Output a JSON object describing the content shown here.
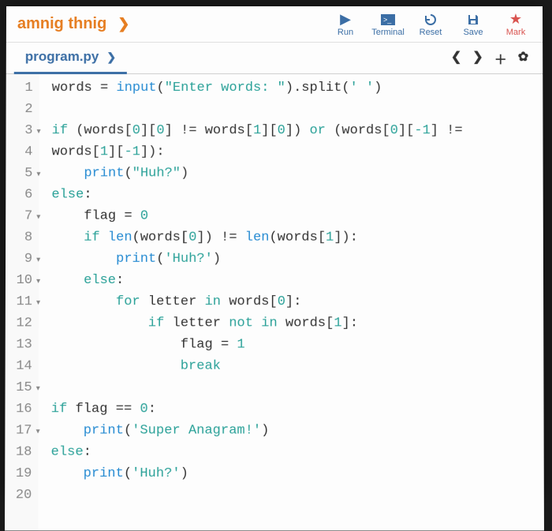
{
  "lesson": {
    "title": "amnig thnig"
  },
  "toolbar": {
    "run": "Run",
    "terminal": "Terminal",
    "reset": "Reset",
    "save": "Save",
    "mark": "Mark"
  },
  "tab": {
    "filename": "program.py"
  },
  "gutter": [
    "1",
    "2",
    "3",
    "4",
    "5",
    "6",
    "7",
    "8",
    "9",
    "10",
    "11",
    "12",
    "13",
    "14",
    "15",
    "16",
    "17",
    "18",
    "19",
    "20"
  ],
  "code": {
    "l1_a": "words = ",
    "l1_fn": "input",
    "l1_b": "(",
    "l1_str1": "\"Enter words: \"",
    "l1_c": ").split(",
    "l1_str2": "' '",
    "l1_d": ")",
    "l3_if": "if",
    "l3_a": " (words[",
    "l3_n0a": "0",
    "l3_b": "][",
    "l3_n0b": "0",
    "l3_c": "] != words[",
    "l3_n1a": "1",
    "l3_d": "][",
    "l3_n0c": "0",
    "l3_e": "]) ",
    "l3_or": "or",
    "l3_f": " (words[",
    "l3_n0d": "0",
    "l3_g": "][",
    "l3_nm1a": "-1",
    "l3_h": "] != ",
    "l3c_a": "words[",
    "l3c_n1": "1",
    "l3c_b": "][",
    "l3c_nm1": "-1",
    "l3c_c": "]):",
    "l4_print": "print",
    "l4_a": "(",
    "l4_str": "\"Huh?\"",
    "l4_b": ")",
    "l5_else": "else",
    "l5_a": ":",
    "l6_a": "flag = ",
    "l6_n": "0",
    "l7_if": "if",
    "l7_a": " ",
    "l7_len1": "len",
    "l7_b": "(words[",
    "l7_n0": "0",
    "l7_c": "]) != ",
    "l7_len2": "len",
    "l7_d": "(words[",
    "l7_n1": "1",
    "l7_e": "]):",
    "l8_print": "print",
    "l8_a": "(",
    "l8_str": "'Huh?'",
    "l8_b": ")",
    "l9_else": "else",
    "l9_a": ":",
    "l10_for": "for",
    "l10_a": " letter ",
    "l10_in": "in",
    "l10_b": " words[",
    "l10_n0": "0",
    "l10_c": "]:",
    "l11_if": "if",
    "l11_a": " letter ",
    "l11_not": "not",
    "l11_sp": " ",
    "l11_in": "in",
    "l11_b": " words[",
    "l11_n1": "1",
    "l11_c": "]:",
    "l12_a": "flag = ",
    "l12_n": "1",
    "l13_break": "break",
    "l15_if": "if",
    "l15_a": " flag == ",
    "l15_n": "0",
    "l15_b": ":",
    "l16_print": "print",
    "l16_a": "(",
    "l16_str": "'Super Anagram!'",
    "l16_b": ")",
    "l17_else": "else",
    "l17_a": ":",
    "l18_print": "print",
    "l18_a": "(",
    "l18_str": "'Huh?'",
    "l18_b": ")"
  }
}
